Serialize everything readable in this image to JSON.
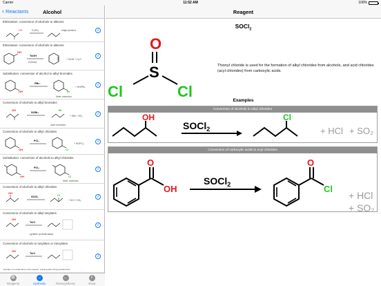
{
  "status_bar": {
    "carrier": "Carrier",
    "time": "11:52 AM",
    "battery": "100%",
    "battery_level": 1.0
  },
  "left_nav": {
    "back_label": "Reactants",
    "title": "Alcohol"
  },
  "list_items": [
    {
      "title": "Elimination: conversion of alcohols to alkenes"
    },
    {
      "title": "Elimination: conversion of alcohols to alkenes"
    },
    {
      "title": "Substitution: conversion of alcohol to alkyl bromides"
    },
    {
      "title": "Conversion of alcohols to alkyl bromides"
    },
    {
      "title": "Conversion of alcohols to alkyl chlorides"
    },
    {
      "title": "Substitution: conversion of alcohols to alkyl chlorides"
    },
    {
      "title": "Conversion of alcohols to alkyl chlorides"
    },
    {
      "title": "Conversion of alcohols to alkyl tosylates"
    },
    {
      "title": "Conversion of alcohols to tosylates or mesylates"
    }
  ],
  "scheme_text": {
    "tsoh": "TsOH",
    "heat": "Δ (heat)",
    "tsoh_h2o": "+ TsOH  + H₂O",
    "pbr3": "PBr₃",
    "hopbr2": "+ HOPBr₂",
    "note_inversion": "Note: inversion",
    "socl2": "SOBr₂",
    "hbr_so2": "+ HBr + SO₂",
    "note_inversion_lower": "note: inversion",
    "pcl5": "PCl₃",
    "hopcl2": "+ HOPCl₂",
    "socl2_b": "SOCl₂",
    "hcl_so2": "+ HCl + SO₂",
    "tscl": "TsCl",
    "pyridine": "pyridine (a weak base)",
    "pyridine_note": "Pyridine is a weak base in the reaction, reacting with HCl generated here"
  },
  "tab_bar": {
    "tabs": [
      {
        "label": "Reagents",
        "icon": "flask-icon",
        "active": false
      },
      {
        "label": "Synthesis",
        "icon": "arrow-right-icon",
        "active": true
      },
      {
        "label": "Retrosynthesis",
        "icon": "arrow-left-icon",
        "active": false
      },
      {
        "label": "About",
        "icon": "info-icon",
        "active": false
      }
    ]
  },
  "right_nav": {
    "title": "Reagent"
  },
  "reagent": {
    "formula_main": "SOCl",
    "formula_sub": "2",
    "atoms": {
      "o": "O",
      "s": "S",
      "cl_left": "Cl",
      "cl_right": "Cl"
    },
    "description": "Thionyl chloride is used for the formation of alkyl chlorides from alcohols, and acid chlorides (acyl chlorides) from carboxylic acids."
  },
  "examples": {
    "title": "Examples",
    "items": [
      {
        "header": "Conversion of alcohols to alkyl chlorides",
        "reactant_group": "OH",
        "reagent": "SOCl",
        "reagent_sub": "2",
        "product_group": "Cl",
        "byproducts": [
          "+ HCl",
          "+ SO₂"
        ]
      },
      {
        "header": "Conversion of carboxylic acids to acyl chlorides",
        "reactant_o": "O",
        "reactant_group": "OH",
        "reagent": "SOCl",
        "reagent_sub": "2",
        "product_o": "O",
        "product_group": "Cl",
        "byproducts": [
          "+ HCl",
          "+ SO₂"
        ]
      }
    ]
  },
  "colors": {
    "accent": "#1478f5",
    "oxygen": "#e8151b",
    "chlorine": "#1ec81e",
    "byproduct": "#9a9a9a",
    "header_gray": "#8f8f8f"
  }
}
